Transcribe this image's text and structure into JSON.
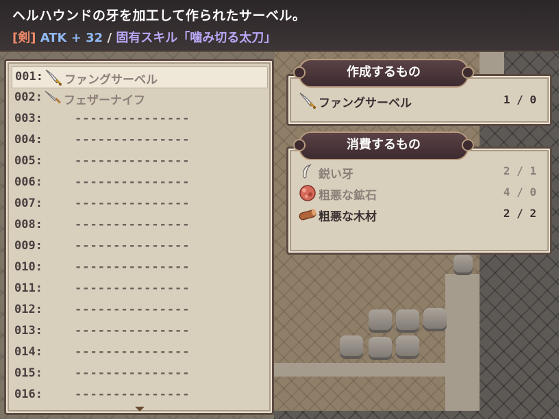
{
  "description": {
    "line1": "ヘルハウンドの牙を加工して作られたサーベル。",
    "tag": "[剣]",
    "atk": "ATK + 32",
    "separator": "/",
    "skill": "固有スキル「噛み切る太刀」"
  },
  "recipe_list": {
    "rows": [
      {
        "num": "001:",
        "name": "ファングサーベル",
        "icon": "saber-icon"
      },
      {
        "num": "002:",
        "name": "フェザーナイフ",
        "icon": "knife-icon"
      },
      {
        "num": "003:",
        "name": "---------------"
      },
      {
        "num": "004:",
        "name": "---------------"
      },
      {
        "num": "005:",
        "name": "---------------"
      },
      {
        "num": "006:",
        "name": "---------------"
      },
      {
        "num": "007:",
        "name": "---------------"
      },
      {
        "num": "008:",
        "name": "---------------"
      },
      {
        "num": "009:",
        "name": "---------------"
      },
      {
        "num": "010:",
        "name": "---------------"
      },
      {
        "num": "011:",
        "name": "---------------"
      },
      {
        "num": "012:",
        "name": "---------------"
      },
      {
        "num": "013:",
        "name": "---------------"
      },
      {
        "num": "014:",
        "name": "---------------"
      },
      {
        "num": "015:",
        "name": "---------------"
      },
      {
        "num": "016:",
        "name": "---------------"
      }
    ]
  },
  "make": {
    "title": "作成するもの",
    "item": {
      "name": "ファングサーベル",
      "qty": "1 /  0",
      "icon": "saber-icon"
    }
  },
  "consume": {
    "title": "消費するもの",
    "items": [
      {
        "name": "鋭い牙",
        "qty": "2 /  1",
        "icon": "fang-icon"
      },
      {
        "name": "粗悪な鉱石",
        "qty": "4 /  0",
        "icon": "ore-icon"
      },
      {
        "name": "粗悪な木材",
        "qty": "2 /  2",
        "icon": "wood-icon"
      }
    ]
  },
  "colors": {
    "tag": "#f08a6a",
    "atk": "#8fb8f0",
    "skill": "#b9a8f5",
    "banner": "#4a3539",
    "panel": "#d9cfbd"
  }
}
